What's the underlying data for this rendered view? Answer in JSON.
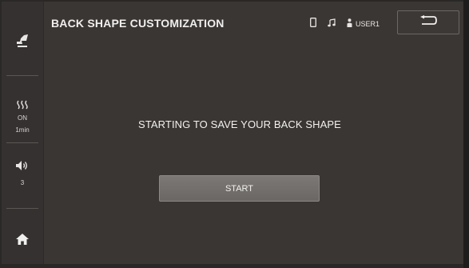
{
  "header": {
    "title": "BACK SHAPE CUSTOMIZATION",
    "user_label": "USER1",
    "icons": [
      "phone-icon",
      "music-note-icon",
      "user-icon",
      "back-arrow-icon"
    ]
  },
  "sidebar": {
    "heat": {
      "icon": "heat-wave-icon",
      "status": "ON",
      "duration": "1min"
    },
    "volume": {
      "icon": "speaker-icon",
      "level": "3"
    },
    "home_icon": "home-icon",
    "mode_icon": "massage-chair-icon"
  },
  "main": {
    "message": "STARTING TO SAVE YOUR BACK SHAPE",
    "start_label": "START"
  },
  "colors": {
    "background": "#3a3634",
    "sidebar": "#343130",
    "button": "#757170",
    "text": "#f2f1ef"
  }
}
